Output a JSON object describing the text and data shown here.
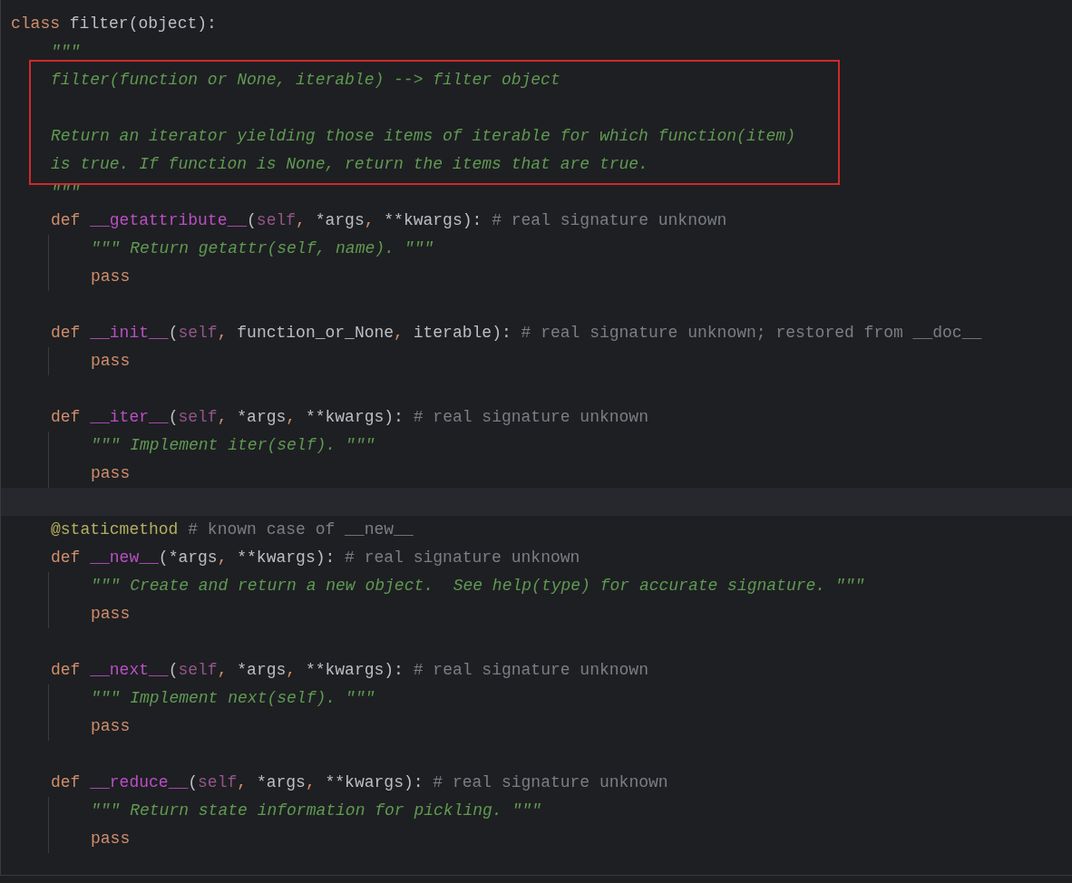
{
  "editor": {
    "lines": [
      {
        "kind": "code",
        "tokens": [
          {
            "kind": "keyword",
            "text": "class"
          },
          {
            "kind": "plain",
            "text": " filter(object):"
          }
        ],
        "children": [
          {
            "kind": "code",
            "tokens": [
              {
                "kind": "doc",
                "text": "\"\"\""
              }
            ]
          },
          {
            "kind": "boxed",
            "children": [
              {
                "kind": "code",
                "tokens": [
                  {
                    "kind": "doc",
                    "text": "filter(function or None, iterable) --> filter object"
                  }
                ]
              },
              {
                "kind": "blank"
              },
              {
                "kind": "code",
                "tokens": [
                  {
                    "kind": "doc",
                    "text": "Return an iterator yielding those items of iterable for which function(item)"
                  }
                ]
              },
              {
                "kind": "code",
                "tokens": [
                  {
                    "kind": "doc",
                    "text": "is true. If function is None, return the items that are true."
                  }
                ]
              }
            ]
          },
          {
            "kind": "code",
            "tokens": [
              {
                "kind": "doc",
                "text": "\"\"\""
              }
            ]
          },
          {
            "kind": "code",
            "tokens": [
              {
                "kind": "keyword",
                "text": "def "
              },
              {
                "kind": "magic",
                "text": "__getattribute__"
              },
              {
                "kind": "plain",
                "text": "("
              },
              {
                "kind": "self",
                "text": "self"
              },
              {
                "kind": "comma",
                "text": ", "
              },
              {
                "kind": "plain",
                "text": "*args"
              },
              {
                "kind": "comma",
                "text": ", "
              },
              {
                "kind": "plain",
                "text": "**kwargs): "
              },
              {
                "kind": "comment",
                "text": "# real signature unknown"
              }
            ],
            "children": [
              {
                "kind": "code",
                "tokens": [
                  {
                    "kind": "doc",
                    "text": "\"\"\" Return getattr(self, name). \"\"\""
                  }
                ]
              },
              {
                "kind": "code",
                "tokens": [
                  {
                    "kind": "keyword",
                    "text": "pass"
                  }
                ]
              }
            ]
          },
          {
            "kind": "blank"
          },
          {
            "kind": "code",
            "tokens": [
              {
                "kind": "keyword",
                "text": "def "
              },
              {
                "kind": "magic",
                "text": "__init__"
              },
              {
                "kind": "plain",
                "text": "("
              },
              {
                "kind": "self",
                "text": "self"
              },
              {
                "kind": "comma",
                "text": ", "
              },
              {
                "kind": "plain",
                "text": "function_or_None"
              },
              {
                "kind": "comma",
                "text": ", "
              },
              {
                "kind": "plain",
                "text": "iterable): "
              },
              {
                "kind": "comment",
                "text": "# real signature unknown; restored from __doc__"
              }
            ],
            "children": [
              {
                "kind": "code",
                "tokens": [
                  {
                    "kind": "keyword",
                    "text": "pass"
                  }
                ]
              }
            ]
          },
          {
            "kind": "blank"
          },
          {
            "kind": "code",
            "tokens": [
              {
                "kind": "keyword",
                "text": "def "
              },
              {
                "kind": "magic",
                "text": "__iter__"
              },
              {
                "kind": "plain",
                "text": "("
              },
              {
                "kind": "self",
                "text": "self"
              },
              {
                "kind": "comma",
                "text": ", "
              },
              {
                "kind": "plain",
                "text": "*args"
              },
              {
                "kind": "comma",
                "text": ", "
              },
              {
                "kind": "plain",
                "text": "**kwargs): "
              },
              {
                "kind": "comment",
                "text": "# real signature unknown"
              }
            ],
            "children": [
              {
                "kind": "code",
                "tokens": [
                  {
                    "kind": "doc",
                    "text": "\"\"\" Implement iter(self). \"\"\""
                  }
                ]
              },
              {
                "kind": "code",
                "tokens": [
                  {
                    "kind": "keyword",
                    "text": "pass"
                  }
                ]
              }
            ]
          },
          {
            "kind": "blank",
            "current": true
          },
          {
            "kind": "code",
            "tokens": [
              {
                "kind": "decorator",
                "text": "@staticmethod"
              },
              {
                "kind": "comment",
                "text": " # known case of __new__"
              }
            ]
          },
          {
            "kind": "code",
            "tokens": [
              {
                "kind": "keyword",
                "text": "def "
              },
              {
                "kind": "magic",
                "text": "__new__"
              },
              {
                "kind": "plain",
                "text": "(*args"
              },
              {
                "kind": "comma",
                "text": ", "
              },
              {
                "kind": "plain",
                "text": "**kwargs): "
              },
              {
                "kind": "comment",
                "text": "# real signature unknown"
              }
            ],
            "children": [
              {
                "kind": "code",
                "tokens": [
                  {
                    "kind": "doc",
                    "text": "\"\"\" Create and return a new object.  See help(type) for accurate signature. \"\"\""
                  }
                ]
              },
              {
                "kind": "code",
                "tokens": [
                  {
                    "kind": "keyword",
                    "text": "pass"
                  }
                ]
              }
            ]
          },
          {
            "kind": "blank"
          },
          {
            "kind": "code",
            "tokens": [
              {
                "kind": "keyword",
                "text": "def "
              },
              {
                "kind": "magic",
                "text": "__next__"
              },
              {
                "kind": "plain",
                "text": "("
              },
              {
                "kind": "self",
                "text": "self"
              },
              {
                "kind": "comma",
                "text": ", "
              },
              {
                "kind": "plain",
                "text": "*args"
              },
              {
                "kind": "comma",
                "text": ", "
              },
              {
                "kind": "plain",
                "text": "**kwargs): "
              },
              {
                "kind": "comment",
                "text": "# real signature unknown"
              }
            ],
            "children": [
              {
                "kind": "code",
                "tokens": [
                  {
                    "kind": "doc",
                    "text": "\"\"\" Implement next(self). \"\"\""
                  }
                ]
              },
              {
                "kind": "code",
                "tokens": [
                  {
                    "kind": "keyword",
                    "text": "pass"
                  }
                ]
              }
            ]
          },
          {
            "kind": "blank"
          },
          {
            "kind": "code",
            "tokens": [
              {
                "kind": "keyword",
                "text": "def "
              },
              {
                "kind": "magic",
                "text": "__reduce__"
              },
              {
                "kind": "plain",
                "text": "("
              },
              {
                "kind": "self",
                "text": "self"
              },
              {
                "kind": "comma",
                "text": ", "
              },
              {
                "kind": "plain",
                "text": "*args"
              },
              {
                "kind": "comma",
                "text": ", "
              },
              {
                "kind": "plain",
                "text": "**kwargs): "
              },
              {
                "kind": "comment",
                "text": "# real signature unknown"
              }
            ],
            "children": [
              {
                "kind": "code",
                "tokens": [
                  {
                    "kind": "doc",
                    "text": "\"\"\" Return state information for pickling. \"\"\""
                  }
                ]
              },
              {
                "kind": "code",
                "tokens": [
                  {
                    "kind": "keyword",
                    "text": "pass"
                  }
                ]
              }
            ]
          }
        ]
      }
    ]
  }
}
